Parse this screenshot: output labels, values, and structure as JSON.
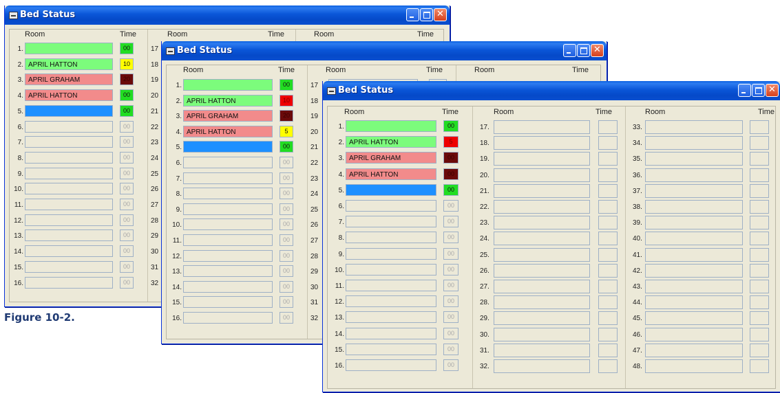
{
  "caption": "Figure 10-2.",
  "window_title": "Bed Status",
  "headers": {
    "room": "Room",
    "time": "Time"
  },
  "colors": {
    "green": "#7cfc7c",
    "salmon": "#f28b8b",
    "blue": "#1e90ff",
    "time_green": "#22dd22",
    "time_yellow": "#ffff00",
    "time_red": "#ee0000",
    "time_dark": "#6b0a0a",
    "empty": "#ece9d8"
  },
  "windows": [
    {
      "beds": [
        {
          "num": "1.",
          "name": "",
          "time": "00",
          "name_color": "green",
          "time_color": "time_green"
        },
        {
          "num": "2.",
          "name": "APRIL HATTON",
          "time": "10",
          "name_color": "green",
          "time_color": "time_yellow"
        },
        {
          "num": "3.",
          "name": "APRIL GRAHAM",
          "time": "20",
          "name_color": "salmon",
          "time_color": "time_dark"
        },
        {
          "num": "4.",
          "name": "APRIL HATTON",
          "time": "00",
          "name_color": "salmon",
          "time_color": "time_green"
        },
        {
          "num": "5.",
          "name": "",
          "time": "00",
          "name_color": "blue",
          "time_color": "time_green"
        },
        {
          "num": "6.",
          "name": "",
          "time": "00"
        },
        {
          "num": "7.",
          "name": "",
          "time": "00"
        },
        {
          "num": "8.",
          "name": "",
          "time": "00"
        },
        {
          "num": "9.",
          "name": "",
          "time": "00"
        },
        {
          "num": "10.",
          "name": "",
          "time": "00"
        },
        {
          "num": "11.",
          "name": "",
          "time": "00"
        },
        {
          "num": "12.",
          "name": "",
          "time": "00"
        },
        {
          "num": "13.",
          "name": "",
          "time": "00"
        },
        {
          "num": "14.",
          "name": "",
          "time": "00"
        },
        {
          "num": "15.",
          "name": "",
          "time": "00"
        },
        {
          "num": "16.",
          "name": "",
          "time": "00"
        }
      ],
      "col2_nums": [
        "17",
        "18",
        "19",
        "20",
        "21",
        "22",
        "23",
        "24",
        "25",
        "26",
        "27",
        "28",
        "29",
        "30",
        "31",
        "32"
      ]
    },
    {
      "beds": [
        {
          "num": "1.",
          "name": "",
          "time": "00",
          "name_color": "green",
          "time_color": "time_green"
        },
        {
          "num": "2.",
          "name": "APRIL HATTON",
          "time": "10",
          "name_color": "green",
          "time_color": "time_red"
        },
        {
          "num": "3.",
          "name": "APRIL GRAHAM",
          "time": "20",
          "name_color": "salmon",
          "time_color": "time_dark"
        },
        {
          "num": "4.",
          "name": "APRIL HATTON",
          "time": "5",
          "name_color": "salmon",
          "time_color": "time_yellow"
        },
        {
          "num": "5.",
          "name": "",
          "time": "00",
          "name_color": "blue",
          "time_color": "time_green"
        },
        {
          "num": "6.",
          "name": "",
          "time": "00"
        },
        {
          "num": "7.",
          "name": "",
          "time": "00"
        },
        {
          "num": "8.",
          "name": "",
          "time": "00"
        },
        {
          "num": "9.",
          "name": "",
          "time": "00"
        },
        {
          "num": "10.",
          "name": "",
          "time": "00"
        },
        {
          "num": "11.",
          "name": "",
          "time": "00"
        },
        {
          "num": "12.",
          "name": "",
          "time": "00"
        },
        {
          "num": "13.",
          "name": "",
          "time": "00"
        },
        {
          "num": "14.",
          "name": "",
          "time": "00"
        },
        {
          "num": "15.",
          "name": "",
          "time": "00"
        },
        {
          "num": "16.",
          "name": "",
          "time": "00"
        }
      ],
      "col2_nums": [
        "17",
        "18",
        "19",
        "20",
        "21",
        "22",
        "23",
        "24",
        "25",
        "26",
        "27",
        "28",
        "29",
        "30",
        "31",
        "32"
      ]
    },
    {
      "beds": [
        {
          "num": "1.",
          "name": "",
          "time": "00",
          "name_color": "green",
          "time_color": "time_green"
        },
        {
          "num": "2.",
          "name": "APRIL HATTON",
          "time": "5",
          "name_color": "green",
          "time_color": "time_red"
        },
        {
          "num": "3.",
          "name": "APRIL GRAHAM",
          "time": "00",
          "name_color": "salmon",
          "time_color": "time_dark"
        },
        {
          "num": "4.",
          "name": "APRIL HATTON",
          "time": "00",
          "name_color": "salmon",
          "time_color": "time_dark"
        },
        {
          "num": "5.",
          "name": "",
          "time": "00",
          "name_color": "blue",
          "time_color": "time_green"
        },
        {
          "num": "6.",
          "name": "",
          "time": "00"
        },
        {
          "num": "7.",
          "name": "",
          "time": "00"
        },
        {
          "num": "8.",
          "name": "",
          "time": "00"
        },
        {
          "num": "9.",
          "name": "",
          "time": "00"
        },
        {
          "num": "10.",
          "name": "",
          "time": "00"
        },
        {
          "num": "11.",
          "name": "",
          "time": "00"
        },
        {
          "num": "12.",
          "name": "",
          "time": "00"
        },
        {
          "num": "13.",
          "name": "",
          "time": "00"
        },
        {
          "num": "14.",
          "name": "",
          "time": "00"
        },
        {
          "num": "15.",
          "name": "",
          "time": "00"
        },
        {
          "num": "16.",
          "name": "",
          "time": "00"
        }
      ],
      "col2_nums": [
        "17.",
        "18.",
        "19.",
        "20.",
        "21.",
        "22.",
        "23.",
        "24.",
        "25.",
        "26.",
        "27.",
        "28.",
        "29.",
        "30.",
        "31.",
        "32."
      ],
      "col3_nums": [
        "33.",
        "34.",
        "35.",
        "36.",
        "37.",
        "38.",
        "39.",
        "40.",
        "41.",
        "42.",
        "43.",
        "44.",
        "45.",
        "46.",
        "47.",
        "48."
      ]
    }
  ]
}
